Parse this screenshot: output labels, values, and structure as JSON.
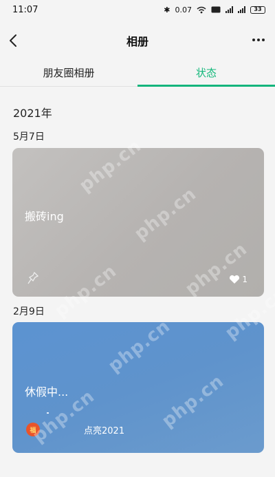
{
  "status_bar": {
    "time": "11:07",
    "network_speed": "0.07",
    "battery": "33"
  },
  "header": {
    "title": "相册"
  },
  "tabs": [
    {
      "label": "朋友圈相册",
      "active": false
    },
    {
      "label": "状态",
      "active": true
    }
  ],
  "year_label": "2021年",
  "entries": [
    {
      "date": "5月7日",
      "text": "搬砖ing",
      "likes": "1"
    },
    {
      "date": "2月9日",
      "text": "休假中...",
      "tag": "点亮2021",
      "tag_badge": "福"
    }
  ],
  "watermark": "php.cn",
  "colors": {
    "accent": "#14b47c",
    "card_grey": "#bebcba",
    "card_blue": "#5f93cc"
  }
}
